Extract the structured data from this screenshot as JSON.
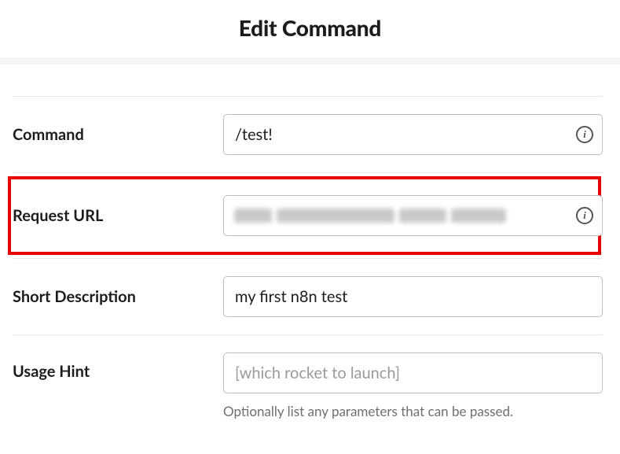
{
  "title": "Edit Command",
  "fields": {
    "command": {
      "label": "Command",
      "value": "/test!",
      "has_info": true
    },
    "request_url": {
      "label": "Request URL",
      "value": "",
      "has_info": true,
      "highlighted": true,
      "redacted": true
    },
    "short_description": {
      "label": "Short Description",
      "value": "my first n8n test",
      "has_info": false
    },
    "usage_hint": {
      "label": "Usage Hint",
      "value": "",
      "placeholder": "[which rocket to launch]",
      "helper": "Optionally list any parameters that can be passed.",
      "has_info": false
    }
  }
}
